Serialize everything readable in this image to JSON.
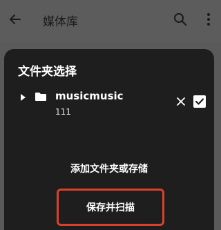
{
  "appbar": {
    "title": "媒体库",
    "back_icon": "arrow-back-icon",
    "search_icon": "search-icon",
    "more_icon": "more-vertical-icon"
  },
  "dialog": {
    "title": "文件夹选择",
    "folder": {
      "name": "musicmusic",
      "subtitle": "111",
      "checked": true
    },
    "add_label": "添加文件夹或存储",
    "save_label": "保存并扫描"
  },
  "colors": {
    "backdrop": "#5a5a5a",
    "sheet": "#1e1e1e",
    "highlight": "#d9412a"
  }
}
